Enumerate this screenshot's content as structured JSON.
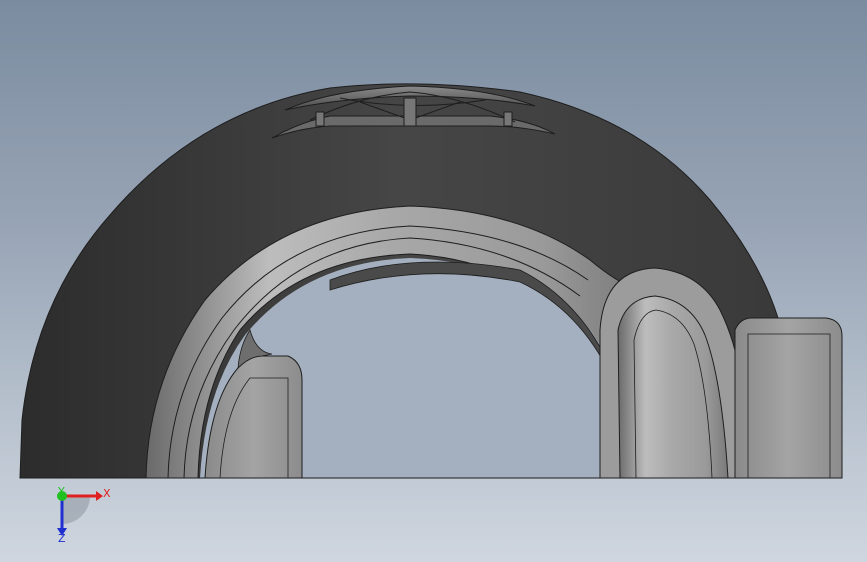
{
  "viewport": {
    "background_top": "#7b8ca0",
    "background_bottom": "#cfd6df"
  },
  "model": {
    "tire_color": "#464646",
    "tire_shadow_color": "#2c2c2c",
    "rim_color": "#9e9e9e",
    "rim_light_color": "#bdbdbd",
    "edge_color": "#1e1e1e"
  },
  "triad": {
    "x_label": "X",
    "y_label": "Y",
    "z_label": "Z",
    "x_color": "#e02020",
    "y_color": "#20c020",
    "z_color": "#2030d0"
  }
}
